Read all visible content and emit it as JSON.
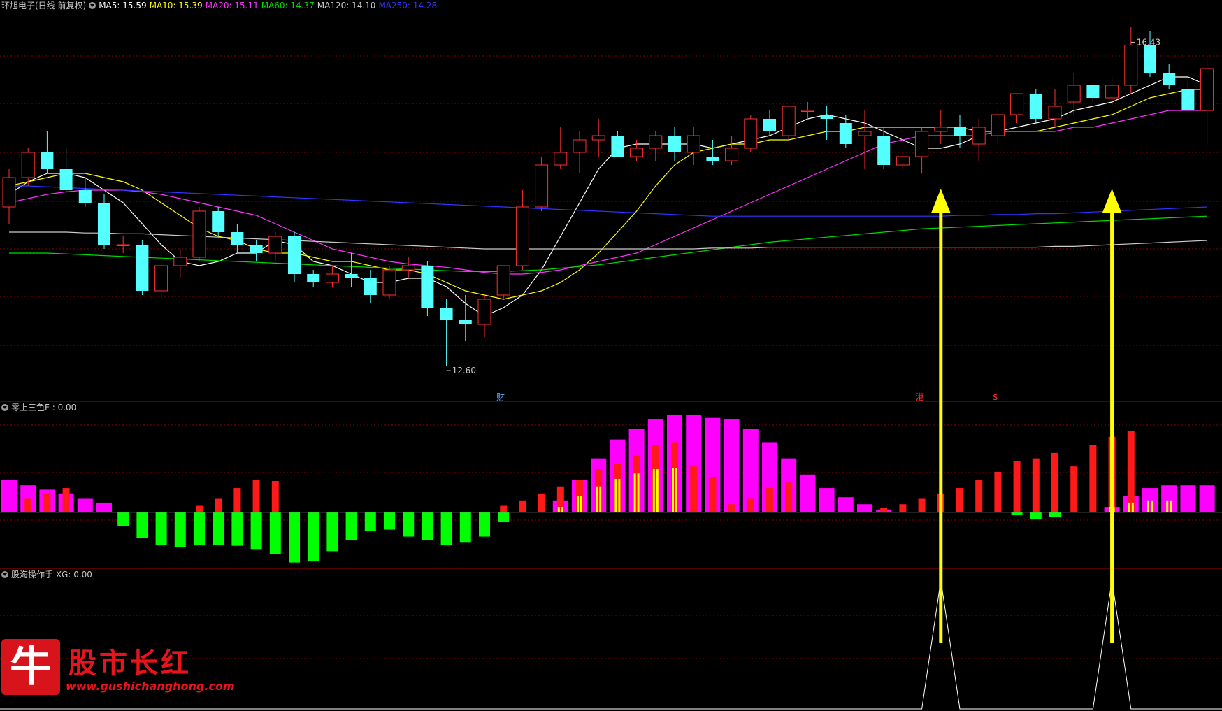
{
  "header": {
    "stock": "环旭电子(日线 前复权)",
    "ma": [
      {
        "label": "MA5: 15.59",
        "color": "#ffffff"
      },
      {
        "label": "MA10: 15.39",
        "color": "#ffff00"
      },
      {
        "label": "MA20: 15.11",
        "color": "#ff33ff"
      },
      {
        "label": "MA60: 14.37",
        "color": "#00dd00"
      },
      {
        "label": "MA120: 14.10",
        "color": "#cccccc"
      },
      {
        "label": "MA250: 14.28",
        "color": "#3333ff"
      }
    ]
  },
  "panel2": {
    "title": "零上三色F : 0.00"
  },
  "panel3": {
    "title": "股海操作手 XG: 0.00"
  },
  "markers": {
    "fin": "财",
    "hk": "港",
    "dollar": "$"
  },
  "logo": {
    "glyph": "牛",
    "title": "股市长红",
    "url": "www.gushichanghong.com"
  },
  "colors": {
    "up": "#ff3030",
    "down": "#54ffff",
    "magenta": "#ff00ff",
    "green": "#00ff00",
    "yellow": "#ffff00",
    "grid": "#8b0000"
  },
  "chart_data": [
    {
      "type": "candlestick",
      "title": "环旭电子(日线 前复权)",
      "price_range": [
        12.2,
        16.8
      ],
      "annotations": [
        {
          "label": "16.43",
          "index": 59,
          "value": 16.43
        },
        {
          "label": "12.60",
          "index": 23,
          "value": 12.6
        }
      ],
      "ohlc": [
        [
          14.5,
          14.95,
          14.3,
          14.85
        ],
        [
          14.85,
          15.2,
          14.75,
          15.15
        ],
        [
          15.15,
          15.4,
          14.9,
          14.95
        ],
        [
          14.95,
          15.2,
          14.65,
          14.7
        ],
        [
          14.7,
          14.85,
          14.5,
          14.55
        ],
        [
          14.55,
          14.65,
          14.0,
          14.05
        ],
        [
          14.05,
          14.15,
          13.95,
          14.05
        ],
        [
          14.05,
          14.1,
          13.45,
          13.5
        ],
        [
          13.5,
          13.85,
          13.4,
          13.8
        ],
        [
          13.8,
          14.0,
          13.65,
          13.9
        ],
        [
          13.9,
          14.5,
          13.85,
          14.45
        ],
        [
          14.45,
          14.5,
          14.15,
          14.2
        ],
        [
          14.2,
          14.3,
          13.95,
          14.05
        ],
        [
          14.05,
          14.1,
          13.85,
          13.95
        ],
        [
          13.95,
          14.2,
          13.85,
          14.15
        ],
        [
          14.15,
          14.2,
          13.6,
          13.7
        ],
        [
          13.7,
          13.75,
          13.55,
          13.6
        ],
        [
          13.6,
          13.8,
          13.55,
          13.7
        ],
        [
          13.7,
          13.95,
          13.55,
          13.65
        ],
        [
          13.65,
          13.75,
          13.35,
          13.45
        ],
        [
          13.45,
          13.8,
          13.4,
          13.75
        ],
        [
          13.75,
          13.9,
          13.65,
          13.8
        ],
        [
          13.8,
          13.85,
          13.2,
          13.3
        ],
        [
          13.3,
          13.4,
          12.6,
          13.15
        ],
        [
          13.15,
          13.45,
          12.9,
          13.1
        ],
        [
          13.1,
          13.45,
          12.95,
          13.4
        ],
        [
          13.45,
          13.8,
          13.4,
          13.8
        ],
        [
          13.8,
          14.7,
          13.75,
          14.5
        ],
        [
          14.5,
          15.1,
          14.45,
          15.0
        ],
        [
          15.0,
          15.45,
          14.95,
          15.15
        ],
        [
          15.15,
          15.4,
          14.9,
          15.3
        ],
        [
          15.3,
          15.55,
          15.1,
          15.35
        ],
        [
          15.35,
          15.4,
          15.1,
          15.1
        ],
        [
          15.1,
          15.3,
          15.05,
          15.2
        ],
        [
          15.2,
          15.4,
          15.05,
          15.35
        ],
        [
          15.35,
          15.45,
          15.05,
          15.15
        ],
        [
          15.15,
          15.45,
          15.0,
          15.35
        ],
        [
          15.1,
          15.3,
          15.0,
          15.05
        ],
        [
          15.05,
          15.35,
          15.0,
          15.2
        ],
        [
          15.2,
          15.6,
          15.15,
          15.55
        ],
        [
          15.55,
          15.65,
          15.35,
          15.4
        ],
        [
          15.35,
          15.7,
          15.3,
          15.7
        ],
        [
          15.65,
          15.75,
          15.55,
          15.65
        ],
        [
          15.6,
          15.7,
          15.3,
          15.55
        ],
        [
          15.5,
          15.6,
          15.2,
          15.25
        ],
        [
          15.35,
          15.65,
          14.95,
          15.4
        ],
        [
          15.35,
          15.45,
          14.95,
          15.0
        ],
        [
          15.0,
          15.15,
          14.95,
          15.1
        ],
        [
          15.1,
          15.45,
          14.9,
          15.4
        ],
        [
          15.4,
          15.65,
          15.25,
          15.45
        ],
        [
          15.45,
          15.6,
          15.2,
          15.35
        ],
        [
          15.25,
          15.55,
          15.05,
          15.45
        ],
        [
          15.35,
          15.65,
          15.25,
          15.6
        ],
        [
          15.6,
          15.85,
          15.5,
          15.85
        ],
        [
          15.85,
          15.9,
          15.5,
          15.55
        ],
        [
          15.55,
          15.9,
          15.45,
          15.7
        ],
        [
          15.75,
          16.1,
          15.6,
          15.95
        ],
        [
          15.95,
          15.95,
          15.75,
          15.8
        ],
        [
          15.8,
          16.05,
          15.7,
          15.95
        ],
        [
          15.95,
          16.65,
          15.85,
          16.43
        ],
        [
          16.43,
          16.6,
          16.05,
          16.1
        ],
        [
          16.1,
          16.2,
          15.9,
          15.95
        ],
        [
          15.9,
          16.0,
          15.65,
          15.65
        ],
        [
          15.65,
          16.3,
          15.25,
          16.15
        ]
      ],
      "lines": [
        {
          "name": "MA5",
          "color": "#ffffff",
          "values": [
            14.65,
            14.8,
            14.9,
            14.9,
            14.85,
            14.7,
            14.55,
            14.3,
            14.05,
            13.85,
            13.8,
            13.85,
            13.95,
            13.95,
            14.1,
            14.05,
            13.85,
            13.8,
            13.7,
            13.6,
            13.6,
            13.65,
            13.65,
            13.55,
            13.35,
            13.2,
            13.3,
            13.45,
            13.75,
            14.15,
            14.55,
            14.95,
            15.2,
            15.25,
            15.25,
            15.25,
            15.25,
            15.2,
            15.25,
            15.3,
            15.35,
            15.45,
            15.55,
            15.6,
            15.55,
            15.5,
            15.4,
            15.3,
            15.2,
            15.2,
            15.25,
            15.35,
            15.4,
            15.45,
            15.5,
            15.55,
            15.65,
            15.7,
            15.75,
            15.85,
            15.95,
            16.05,
            16.05,
            15.95
          ]
        },
        {
          "name": "MA10",
          "color": "#ffff00",
          "values": [
            14.75,
            14.8,
            14.85,
            14.9,
            14.9,
            14.85,
            14.8,
            14.7,
            14.55,
            14.4,
            14.25,
            14.15,
            14.1,
            14.0,
            13.95,
            13.95,
            13.9,
            13.85,
            13.85,
            13.8,
            13.75,
            13.75,
            13.7,
            13.6,
            13.5,
            13.45,
            13.4,
            13.45,
            13.5,
            13.6,
            13.75,
            13.95,
            14.2,
            14.45,
            14.75,
            15.0,
            15.15,
            15.2,
            15.25,
            15.25,
            15.3,
            15.3,
            15.35,
            15.4,
            15.4,
            15.45,
            15.45,
            15.45,
            15.45,
            15.45,
            15.45,
            15.4,
            15.4,
            15.4,
            15.4,
            15.45,
            15.5,
            15.55,
            15.6,
            15.7,
            15.8,
            15.85,
            15.9,
            15.9
          ]
        },
        {
          "name": "MA20",
          "color": "#ff33ff",
          "values": [
            14.55,
            14.6,
            14.65,
            14.68,
            14.7,
            14.7,
            14.7,
            14.68,
            14.65,
            14.6,
            14.55,
            14.5,
            14.45,
            14.4,
            14.3,
            14.2,
            14.1,
            14.0,
            13.95,
            13.9,
            13.85,
            13.82,
            13.8,
            13.78,
            13.75,
            13.72,
            13.7,
            13.7,
            13.72,
            13.75,
            13.8,
            13.85,
            13.9,
            13.95,
            14.05,
            14.15,
            14.25,
            14.35,
            14.45,
            14.55,
            14.65,
            14.75,
            14.85,
            14.95,
            15.05,
            15.15,
            15.25,
            15.3,
            15.35,
            15.35,
            15.35,
            15.35,
            15.4,
            15.4,
            15.4,
            15.4,
            15.45,
            15.45,
            15.5,
            15.55,
            15.6,
            15.65,
            15.65,
            15.65
          ]
        },
        {
          "name": "MA60",
          "color": "#00dd00",
          "values": [
            13.95,
            13.95,
            13.95,
            13.94,
            13.93,
            13.92,
            13.91,
            13.9,
            13.89,
            13.88,
            13.87,
            13.86,
            13.85,
            13.84,
            13.83,
            13.82,
            13.81,
            13.8,
            13.79,
            13.78,
            13.77,
            13.76,
            13.75,
            13.74,
            13.73,
            13.73,
            13.73,
            13.74,
            13.75,
            13.77,
            13.79,
            13.81,
            13.84,
            13.87,
            13.9,
            13.93,
            13.96,
            13.99,
            14.02,
            14.05,
            14.08,
            14.1,
            14.12,
            14.14,
            14.16,
            14.18,
            14.2,
            14.22,
            14.24,
            14.25,
            14.26,
            14.27,
            14.28,
            14.29,
            14.3,
            14.31,
            14.32,
            14.33,
            14.34,
            14.35,
            14.36,
            14.37,
            14.38,
            14.39
          ]
        },
        {
          "name": "MA120",
          "color": "#cccccc",
          "values": [
            14.2,
            14.2,
            14.2,
            14.2,
            14.19,
            14.19,
            14.18,
            14.18,
            14.17,
            14.16,
            14.15,
            14.14,
            14.13,
            14.12,
            14.11,
            14.1,
            14.09,
            14.08,
            14.07,
            14.06,
            14.05,
            14.04,
            14.03,
            14.02,
            14.01,
            14.0,
            14.0,
            14.0,
            14.0,
            14.0,
            14.0,
            14.0,
            14.0,
            14.0,
            14.0,
            14.0,
            14.0,
            14.01,
            14.01,
            14.01,
            14.02,
            14.02,
            14.02,
            14.02,
            14.02,
            14.02,
            14.02,
            14.02,
            14.02,
            14.02,
            14.02,
            14.02,
            14.02,
            14.02,
            14.02,
            14.03,
            14.03,
            14.04,
            14.05,
            14.06,
            14.07,
            14.08,
            14.09,
            14.1
          ]
        },
        {
          "name": "MA250",
          "color": "#3333ff",
          "values": [
            14.75,
            14.75,
            14.74,
            14.73,
            14.72,
            14.71,
            14.7,
            14.69,
            14.68,
            14.67,
            14.66,
            14.65,
            14.64,
            14.63,
            14.62,
            14.61,
            14.6,
            14.59,
            14.58,
            14.57,
            14.56,
            14.55,
            14.54,
            14.53,
            14.52,
            14.51,
            14.5,
            14.49,
            14.48,
            14.47,
            14.46,
            14.45,
            14.44,
            14.43,
            14.42,
            14.41,
            14.4,
            14.39,
            14.39,
            14.39,
            14.39,
            14.39,
            14.39,
            14.39,
            14.39,
            14.39,
            14.39,
            14.39,
            14.39,
            14.39,
            14.4,
            14.4,
            14.41,
            14.41,
            14.42,
            14.42,
            14.43,
            14.44,
            14.45,
            14.46,
            14.47,
            14.48,
            14.49,
            14.5
          ]
        }
      ]
    },
    {
      "type": "bar",
      "title": "零上三色F : 0.00",
      "value_range": [
        -1.0,
        1.85
      ],
      "magenta": [
        0.6,
        0.5,
        0.42,
        0.35,
        0.25,
        0.18,
        0,
        0,
        0,
        0,
        0,
        0,
        0,
        0,
        0,
        0,
        0,
        0,
        0,
        0,
        0,
        0,
        0,
        0,
        0,
        0,
        0,
        0,
        0,
        0.22,
        0.6,
        1.0,
        1.35,
        1.55,
        1.72,
        1.8,
        1.8,
        1.75,
        1.72,
        1.55,
        1.3,
        1.0,
        0.7,
        0.45,
        0.28,
        0.15,
        0.05,
        0,
        0,
        0,
        0,
        0,
        0,
        0,
        0,
        0,
        0,
        0,
        0.1,
        0.3,
        0.45,
        0.5,
        0.5,
        0.5
      ],
      "red": [
        0,
        0.25,
        0.35,
        0.45,
        0,
        0,
        0,
        0,
        0,
        0,
        0.12,
        0.25,
        0.45,
        0.6,
        0.58,
        0,
        0,
        0,
        0,
        0,
        0,
        0,
        0,
        0,
        0,
        0,
        0.12,
        0.22,
        0.35,
        0.48,
        0.6,
        0.8,
        0.9,
        1.05,
        1.25,
        1.3,
        0.85,
        0.65,
        0.15,
        0.25,
        0.45,
        0.55,
        0,
        0,
        0,
        0,
        0.08,
        0.15,
        0.25,
        0.35,
        0.45,
        0.6,
        0.75,
        0.95,
        1.0,
        1.1,
        0.85,
        1.25,
        1.4,
        1.5,
        0,
        0,
        0,
        0
      ],
      "yellow": [
        0,
        0,
        0,
        0,
        0,
        0,
        0,
        0,
        0,
        0,
        0,
        0,
        0,
        0,
        0,
        0,
        0,
        0,
        0,
        0,
        0,
        0,
        0,
        0,
        0,
        0,
        0,
        0,
        0,
        0.1,
        0.3,
        0.48,
        0.62,
        0.72,
        0.8,
        0.82,
        0,
        0,
        0,
        0,
        0,
        0,
        0,
        0,
        0,
        0,
        0,
        0,
        0,
        0,
        0,
        0,
        0,
        0,
        0,
        0,
        0,
        0,
        0.1,
        0.18,
        0.22,
        0.22,
        0,
        0
      ],
      "green": [
        0,
        0,
        0,
        0,
        0,
        0,
        0.25,
        0.48,
        0.6,
        0.65,
        0.6,
        0.6,
        0.62,
        0.68,
        0.77,
        0.93,
        0.9,
        0.72,
        0.52,
        0.35,
        0.32,
        0.45,
        0.52,
        0.6,
        0.55,
        0.45,
        0.18,
        0,
        0,
        0,
        0,
        0,
        0,
        0,
        0,
        0,
        0,
        0,
        0,
        0,
        0,
        0,
        0,
        0,
        0,
        0,
        0,
        0,
        0,
        0,
        0,
        0,
        0,
        0.05,
        0.12,
        0.08,
        0,
        0,
        0,
        0,
        0,
        0,
        0,
        0
      ]
    },
    {
      "type": "line",
      "title": "股海操作手 XG: 0.00",
      "value_range": [
        0,
        1
      ],
      "signal_indices": [
        49,
        58
      ]
    }
  ]
}
